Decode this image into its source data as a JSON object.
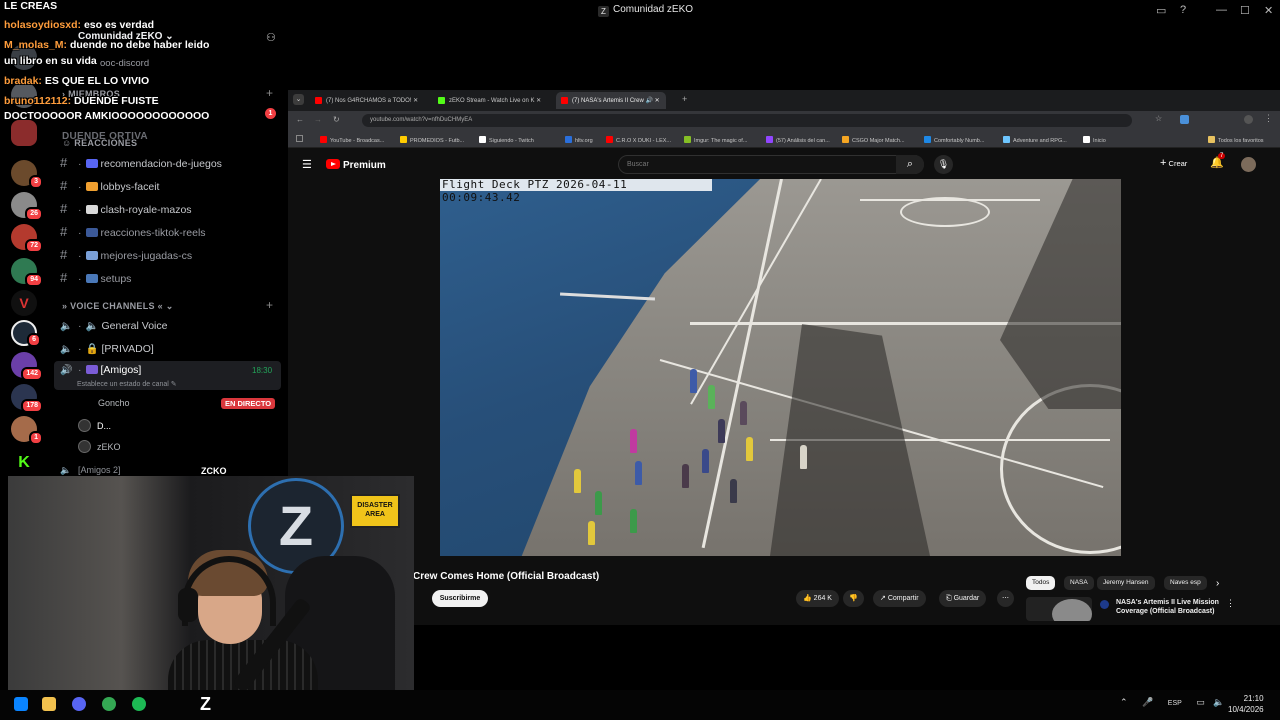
{
  "window": {
    "title": "Comunidad zEKO"
  },
  "chat": [
    {
      "user": "",
      "msg": "LE CREAS"
    },
    {
      "user": "holasoydiosxd:",
      "msg": "eso es verdad"
    },
    {
      "user": "M_molas_M:",
      "msg": "duende no debe haber leido"
    },
    {
      "user": "",
      "msg": "un libro en su vida"
    },
    {
      "user": "bradak:",
      "msg": "ES QUE EL LO VIVIO"
    },
    {
      "user": "bruno112112:",
      "msg": "DUENDE FUISTE"
    },
    {
      "user": "",
      "msg": "DOCTOOOOOR AMKIOOOOOOOOOOOO"
    }
  ],
  "server": {
    "name": "Comunidad zEKO",
    "partial_channel": "ooc-discord",
    "cat_miembros": "MIEMBROS",
    "cat_duende": "DUENDE ORTIVA",
    "cat_reacciones": "REACCIONES",
    "text_channels": [
      "recomendacion-de-juegos",
      "lobbys-faceit",
      "clash-royale-mazos",
      "reacciones-tiktok-reels",
      "mejores-jugadas-cs",
      "setups"
    ],
    "cat_voice": "VOICE CHANNELS",
    "voice_channels": [
      "General Voice",
      "[PRIVADO]",
      "[Amigos]"
    ],
    "amigos_time": "18:30",
    "amigos_status": "Establece un estado de canal",
    "voice_users": [
      "Goncho",
      "D...",
      "zEKO"
    ],
    "live_badge": "EN DIRECTO",
    "next_channel": "[Amigos 2]",
    "mention_count": "1"
  },
  "rail_badges": [
    "3",
    "26",
    "72",
    "94",
    "6",
    "142",
    "178",
    "1"
  ],
  "browser": {
    "tabs": [
      "(7) Nos G4RCHAMOS a TODO!",
      "zEKO Stream - Watch Live on K",
      "(7) NASA's Artemis II Crew"
    ],
    "url": "youtube.com/watch?v=nfhDuCHMyEA",
    "bookmarks": [
      "YouTube - Broadcas...",
      "PROMEDIOS - Futb...",
      "Siguiendo - Twitch",
      "hltv.org",
      "C.R.O X DUKI - LEX...",
      "Imgur: The magic of...",
      "(57) Análisis del can...",
      "CSGO Major Match...",
      "Comfortably Numb...",
      "Adventure and RPG...",
      "Inicio",
      "Todos los favoritos"
    ]
  },
  "youtube": {
    "logo_text": "Premium",
    "search_placeholder": "Buscar",
    "create_label": "Crear",
    "notif_count": "7",
    "video_timestamp": "Flight Deck PTZ 2026-04-11 00:09:43.42",
    "video_title": "Crew Comes Home (Official Broadcast)",
    "subscribe_label": "Suscribirme",
    "likes": "264 K",
    "share_label": "Compartir",
    "save_label": "Guardar",
    "chips": [
      "Todos",
      "NASA",
      "Jeremy Hansen",
      "Naves esp"
    ],
    "rec_title": "NASA's Artemis II Live Mission Coverage (Official Broadcast)"
  },
  "webcam": {
    "label": "ZCKO",
    "sign_text": "DISASTER AREA"
  },
  "taskbar": {
    "lang": "ESP",
    "time": "21:10",
    "date": "10/4/2026"
  }
}
